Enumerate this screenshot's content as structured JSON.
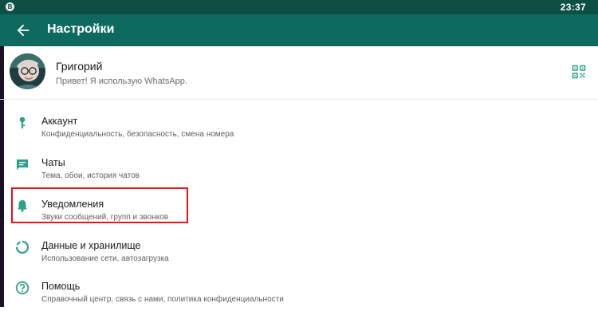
{
  "status_bar": {
    "app_badge": "B",
    "time": "23:37"
  },
  "app_bar": {
    "title": "Настройки"
  },
  "profile": {
    "name": "Григорий",
    "status": "Привет! Я использую WhatsApp."
  },
  "menu": [
    {
      "title": "Аккаунт",
      "subtitle": "Конфиденциальность, безопасность, смена номера",
      "icon": "key-icon"
    },
    {
      "title": "Чаты",
      "subtitle": "Тема, обои, история чатов",
      "icon": "chat-icon"
    },
    {
      "title": "Уведомления",
      "subtitle": "Звуки сообщений, групп и звонков",
      "icon": "bell-icon"
    },
    {
      "title": "Данные и хранилище",
      "subtitle": "Использование сети, автозагрузка",
      "icon": "data-usage-icon"
    },
    {
      "title": "Помощь",
      "subtitle": "Справочный центр, связь с нами, политика конфиденциальности",
      "icon": "help-icon"
    }
  ],
  "colors": {
    "status_bar": "#0d4e45",
    "app_bar": "#0e6a5e",
    "icon_tint": "#2fa08a",
    "highlight": "#e0161b"
  }
}
